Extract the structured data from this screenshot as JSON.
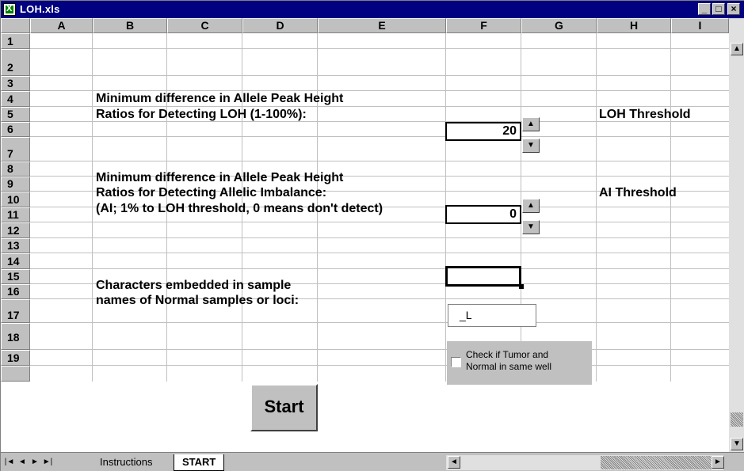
{
  "window": {
    "title": "LOH.xls",
    "minimize": "_",
    "restore": "□",
    "close": "×"
  },
  "columns": [
    "A",
    "B",
    "C",
    "D",
    "E",
    "F",
    "G",
    "H",
    "I"
  ],
  "rows": [
    "1",
    "2",
    "3",
    "4",
    "5",
    "6",
    "7",
    "8",
    "9",
    "10",
    "11",
    "12",
    "13",
    "14",
    "15",
    "16",
    "17",
    "18",
    "19"
  ],
  "cells": {
    "b3": "Minimum difference in Allele Peak Height",
    "b4": "Ratios for Detecting LOH (1-100%):",
    "b7": "Minimum difference in Allele Peak Height",
    "b8": "Ratios for Detecting Allelic Imbalance:",
    "b9": "(AI; 1% to LOH threshold, 0 means don't detect)",
    "b12": "Characters embedded in sample",
    "b13": "names of Normal samples or loci:",
    "h4": "LOH Threshold",
    "h8": "AI Threshold"
  },
  "loh_threshold": {
    "value": "20"
  },
  "ai_threshold": {
    "value": "0"
  },
  "normal_chars": {
    "value": "_L"
  },
  "checkbox": {
    "label_line1": "Check if Tumor and",
    "label_line2": "Normal in same well",
    "checked": false
  },
  "start_button": {
    "label": "Start"
  },
  "sheet_tabs": [
    "Instructions",
    "START"
  ],
  "active_sheet": "START",
  "icons": {
    "spin_up": "▲",
    "spin_down": "▼",
    "scroll_up": "▲",
    "scroll_down": "▼",
    "scroll_left": "◄",
    "scroll_right": "►",
    "first_tab": "|◄",
    "prev_tab": "◄",
    "next_tab": "►",
    "last_tab": "►|"
  }
}
